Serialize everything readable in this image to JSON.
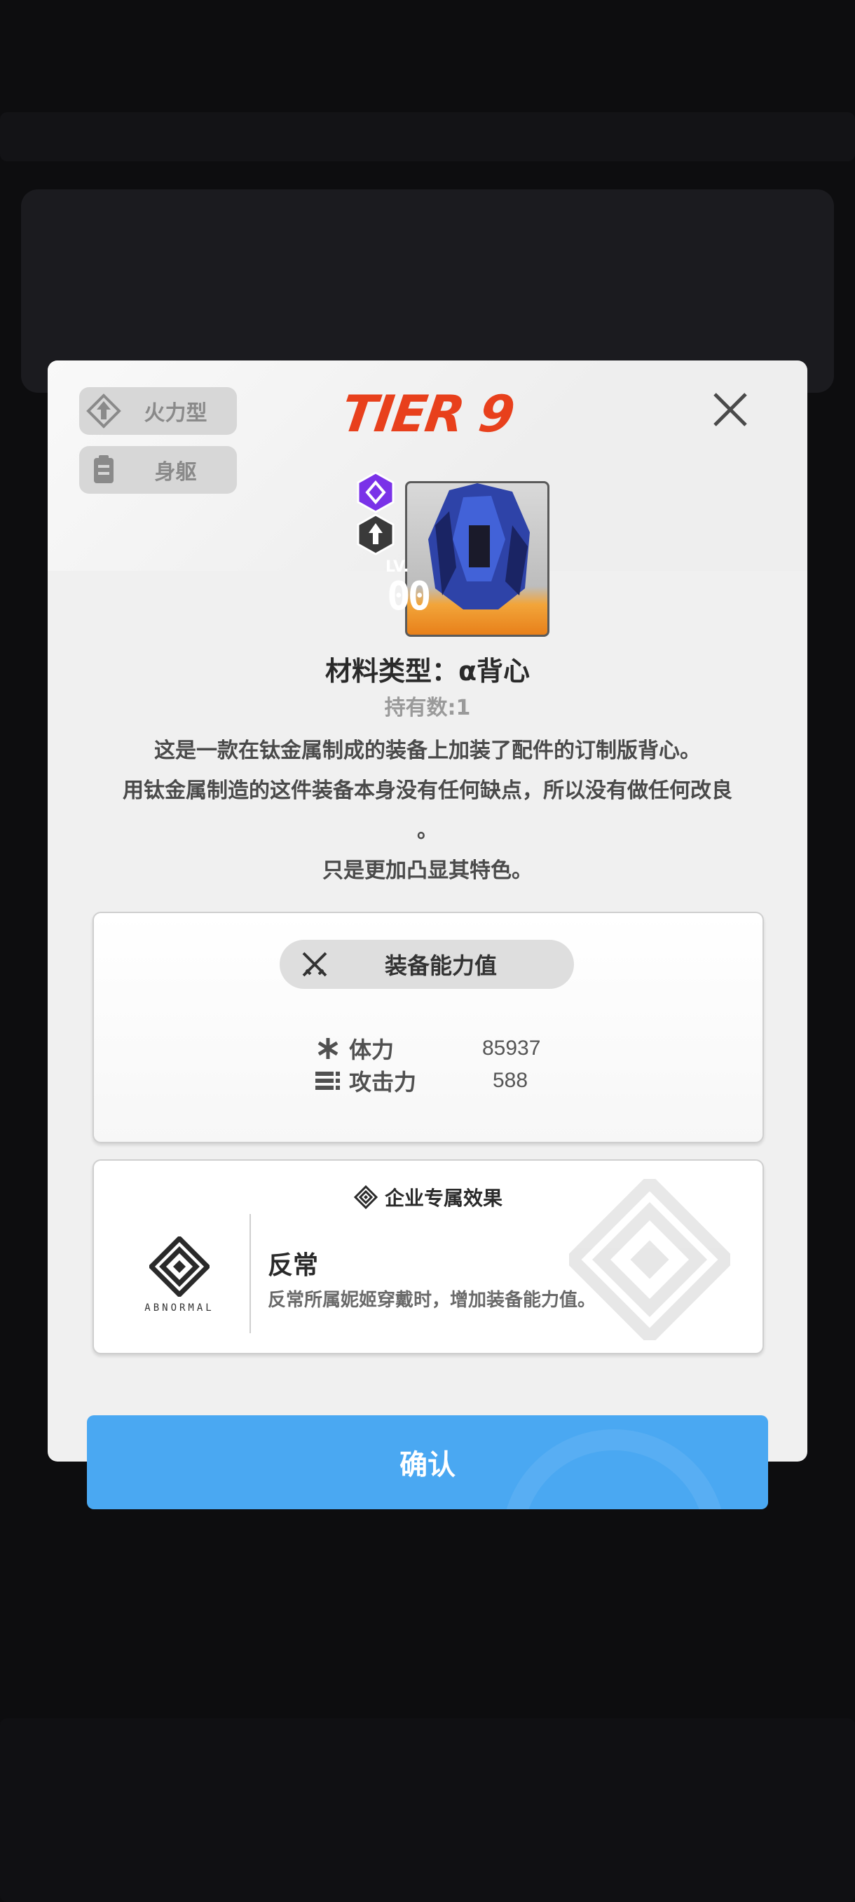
{
  "item": {
    "tier": "TIER 9",
    "lv_label": "LV.",
    "lv_value": "00",
    "title": "材料类型：α背心",
    "owned": "持有数:1",
    "description": [
      "这是一款在钛金属制成的装备上加装了配件的订制版背心。",
      "用钛金属制造的这件装备本身没有任何缺点，所以没有做任何改良",
      "。",
      "只是更加凸显其特色。"
    ],
    "rarity_color": "#e8401c"
  },
  "tags": [
    {
      "label": "火力型",
      "icon": "firepower-icon"
    },
    {
      "label": "身躯",
      "icon": "body-armor-icon"
    }
  ],
  "stats": {
    "header": "装备能力值",
    "rows": [
      {
        "label": "体力",
        "value": "85937",
        "icon": "asterisk-icon"
      },
      {
        "label": "攻击力",
        "value": "588",
        "icon": "ammo-icon"
      }
    ]
  },
  "corp": {
    "header": "企业专属效果",
    "logo_text": "ABNORMAL",
    "name": "反常",
    "effect": "反常所属妮姬穿戴时，增加装备能力值。"
  },
  "confirm_label": "确认",
  "colors": {
    "accent_blue": "#4aa8f2",
    "tier_red": "#e8401c",
    "modal_bg": "#f0f0f0"
  }
}
